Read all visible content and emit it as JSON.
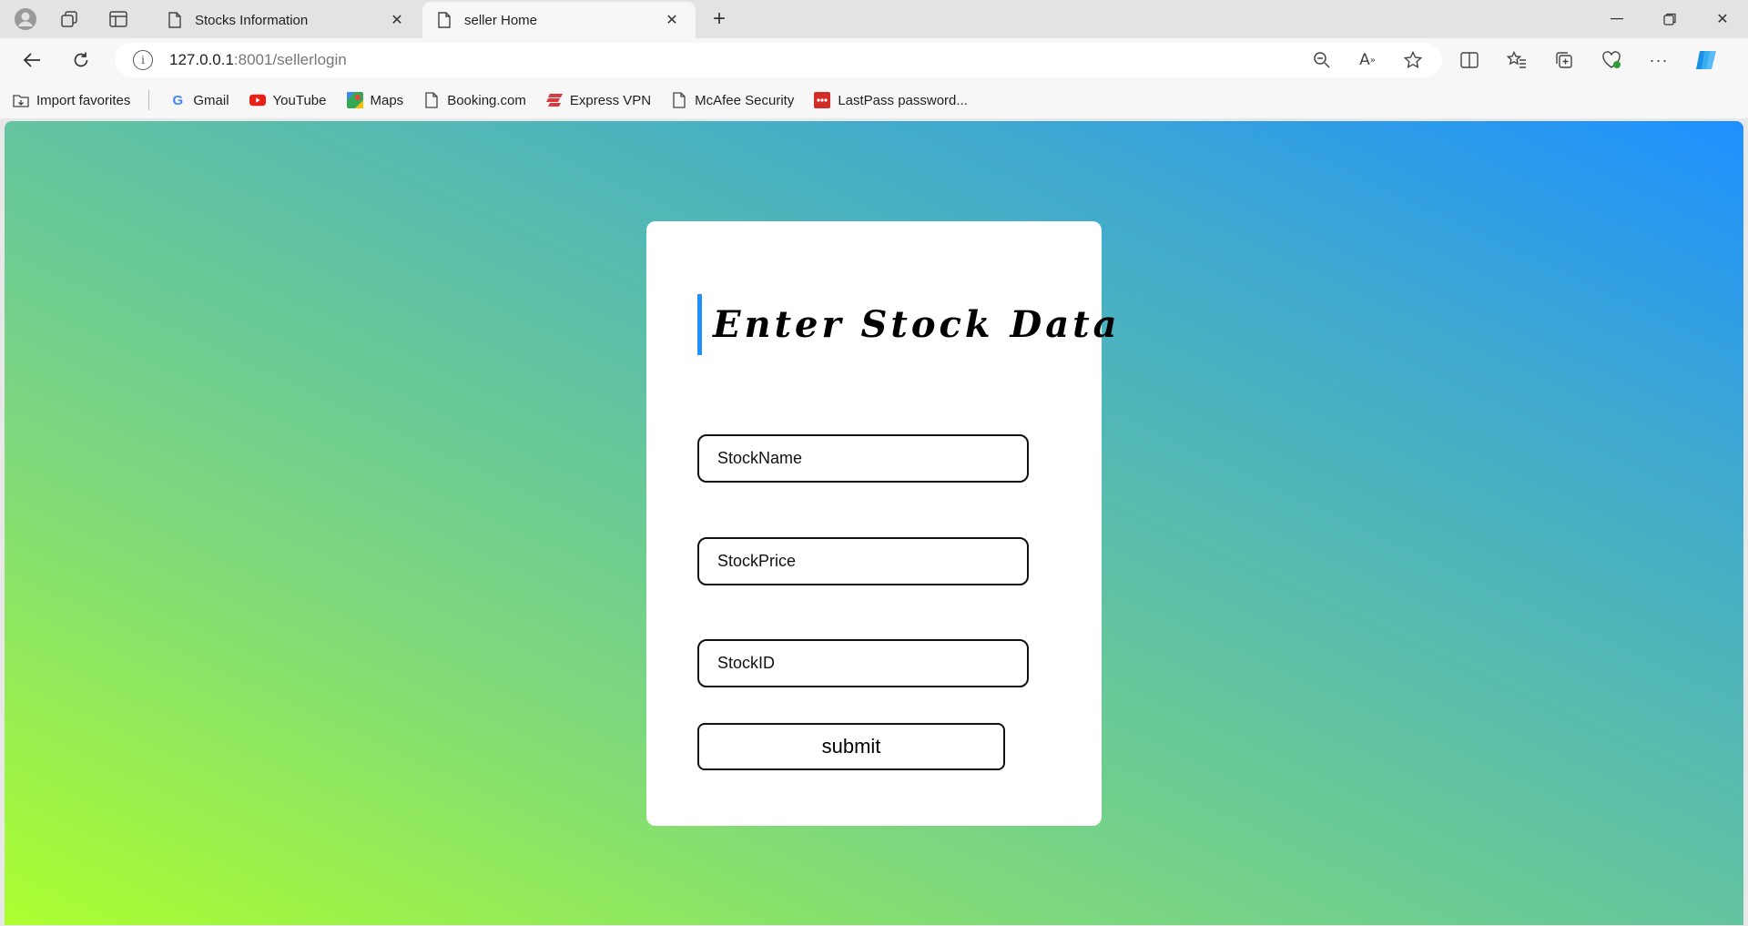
{
  "browser": {
    "tabs": [
      {
        "title": "Stocks Information",
        "active": false
      },
      {
        "title": "seller Home",
        "active": true
      }
    ],
    "address": {
      "host": "127.0.0.1",
      "path": ":8001/sellerlogin"
    },
    "bookmarks": [
      {
        "label": "Import favorites",
        "icon": "import-icon"
      },
      {
        "label": "Gmail",
        "icon": "google-icon"
      },
      {
        "label": "YouTube",
        "icon": "youtube-icon"
      },
      {
        "label": "Maps",
        "icon": "maps-icon"
      },
      {
        "label": "Booking.com",
        "icon": "page-icon"
      },
      {
        "label": "Express VPN",
        "icon": "expressvpn-icon"
      },
      {
        "label": "McAfee Security",
        "icon": "page-icon"
      },
      {
        "label": "LastPass password...",
        "icon": "lastpass-icon"
      }
    ]
  },
  "form": {
    "heading": "Enter Stock Data",
    "fields": [
      {
        "placeholder": "StockName"
      },
      {
        "placeholder": "StockPrice"
      },
      {
        "placeholder": "StockID"
      }
    ],
    "submit_label": "submit"
  },
  "colors": {
    "accent": "#1e90ff",
    "gradient_start": "#adff2f",
    "gradient_end": "#1e90ff"
  }
}
